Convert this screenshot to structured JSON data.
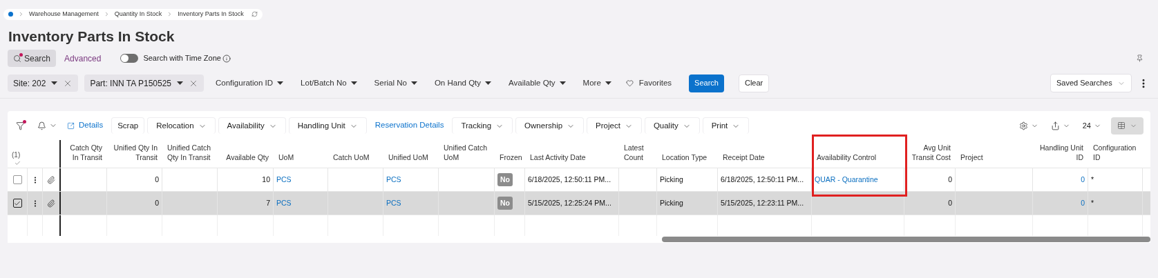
{
  "breadcrumb": [
    "Warehouse Management",
    "Quantity In Stock",
    "Inventory Parts In Stock"
  ],
  "title": "Inventory Parts In Stock",
  "search_mode": {
    "search": "Search",
    "advanced": "Advanced",
    "time_zone_toggle": {
      "label": "Search with Time Zone",
      "on": false
    }
  },
  "filters": [
    {
      "kind": "chip",
      "label": "Site: 202"
    },
    {
      "kind": "chip",
      "label": "Part: INN TA P150525"
    },
    {
      "kind": "dropdown",
      "label": "Configuration ID"
    },
    {
      "kind": "dropdown",
      "label": "Lot/Batch No"
    },
    {
      "kind": "dropdown",
      "label": "Serial No"
    },
    {
      "kind": "dropdown",
      "label": "On Hand Qty"
    },
    {
      "kind": "dropdown",
      "label": "Available Qty"
    },
    {
      "kind": "dropdown",
      "label": "More"
    },
    {
      "kind": "favorites",
      "label": "Favorites"
    },
    {
      "kind": "primary",
      "label": "Search"
    },
    {
      "kind": "secondary",
      "label": "Clear"
    }
  ],
  "saved_searches": "Saved Searches",
  "toolbar": [
    {
      "kind": "link",
      "label": "Details"
    },
    {
      "kind": "button",
      "label": "Scrap"
    },
    {
      "kind": "menu",
      "label": "Relocation"
    },
    {
      "kind": "menu",
      "label": "Availability"
    },
    {
      "kind": "menu",
      "label": "Handling Unit"
    },
    {
      "kind": "link",
      "label": "Reservation Details"
    },
    {
      "kind": "menu",
      "label": "Tracking"
    },
    {
      "kind": "menu",
      "label": "Ownership"
    },
    {
      "kind": "menu",
      "label": "Project"
    },
    {
      "kind": "menu",
      "label": "Quality"
    },
    {
      "kind": "menu",
      "label": "Print"
    }
  ],
  "page_size": "24",
  "selection_count": "(1)",
  "table": {
    "columns": [
      {
        "label": "Catch Qty In Transit",
        "kind": "number",
        "highlighted": false
      },
      {
        "label": "Unified Qty In Transit",
        "kind": "number",
        "highlighted": false
      },
      {
        "label": "Unified Catch Qty In Transit",
        "kind": "text",
        "highlighted": false
      },
      {
        "label": "Available Qty",
        "kind": "number",
        "highlighted": false
      },
      {
        "label": "UoM",
        "kind": "link",
        "highlighted": false
      },
      {
        "label": "Catch UoM",
        "kind": "text",
        "highlighted": false
      },
      {
        "label": "Unified UoM",
        "kind": "link",
        "highlighted": false
      },
      {
        "label": "Unified Catch UoM",
        "kind": "text",
        "highlighted": false
      },
      {
        "label": "Frozen",
        "kind": "badge",
        "highlighted": false
      },
      {
        "label": "Last Activity Date",
        "kind": "text",
        "highlighted": false
      },
      {
        "label": "Latest Count",
        "kind": "text",
        "highlighted": false
      },
      {
        "label": "Location Type",
        "kind": "text",
        "highlighted": false
      },
      {
        "label": "Receipt Date",
        "kind": "text",
        "highlighted": false
      },
      {
        "label": "Availability Control",
        "kind": "link",
        "highlighted": true
      },
      {
        "label": "Avg Unit Transit Cost",
        "kind": "number",
        "highlighted": false
      },
      {
        "label": "Project",
        "kind": "text",
        "highlighted": false
      },
      {
        "label": "Handling Unit ID",
        "kind": "link_number",
        "highlighted": false
      },
      {
        "label": "Configuration ID",
        "kind": "text",
        "highlighted": false
      }
    ],
    "rows": [
      {
        "selected": false,
        "cells": [
          null,
          "0",
          null,
          "10",
          "PCS",
          null,
          "PCS",
          null,
          "No",
          "6/18/2025, 12:50:11 PM...",
          null,
          "Picking",
          "6/18/2025, 12:50:11 PM...",
          "QUAR - Quarantine",
          "0",
          null,
          "0",
          "*"
        ]
      },
      {
        "selected": true,
        "cells": [
          null,
          "0",
          null,
          "7",
          "PCS",
          null,
          "PCS",
          null,
          "No",
          "5/15/2025, 12:25:24 PM...",
          null,
          "Picking",
          "5/15/2025, 12:23:11 PM...",
          null,
          "0",
          null,
          "0",
          "*"
        ]
      }
    ]
  }
}
